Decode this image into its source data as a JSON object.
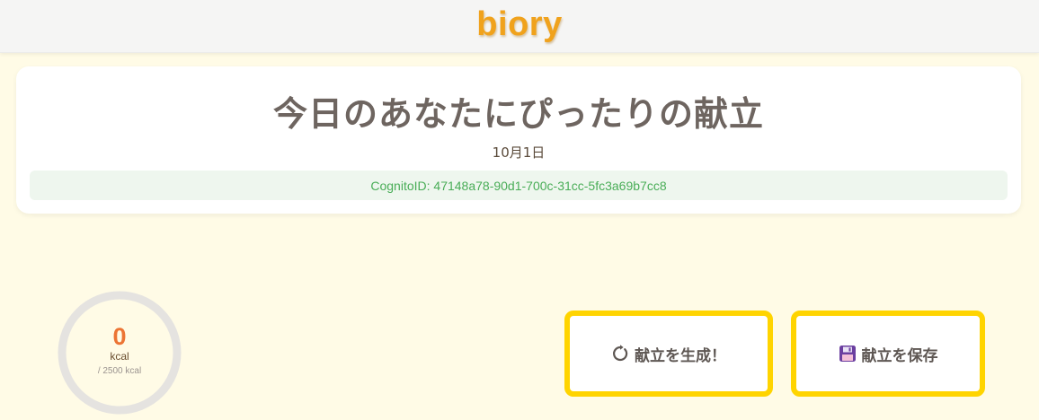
{
  "header": {
    "logo": "biory"
  },
  "menu_card": {
    "title": "今日のあなたにぴったりの献立",
    "date": "10月1日",
    "cognito_id": "CognitoID: 47148a78-90d1-700c-31cc-5fc3a69b7cc8"
  },
  "calories": {
    "value": "0",
    "unit": "kcal",
    "goal": "/ 2500 kcal",
    "progress": 0
  },
  "actions": {
    "generate_label": "献立を生成！",
    "generate_icon": "refresh-icon",
    "save_label": "献立を保存",
    "save_icon": "floppy-disk-icon"
  },
  "colors": {
    "page_background": "#fffbe6",
    "logo": "#f0a21c",
    "calorie_value": "#ec7434",
    "cognito_text": "#49ad57",
    "button_border": "#ffd400"
  }
}
